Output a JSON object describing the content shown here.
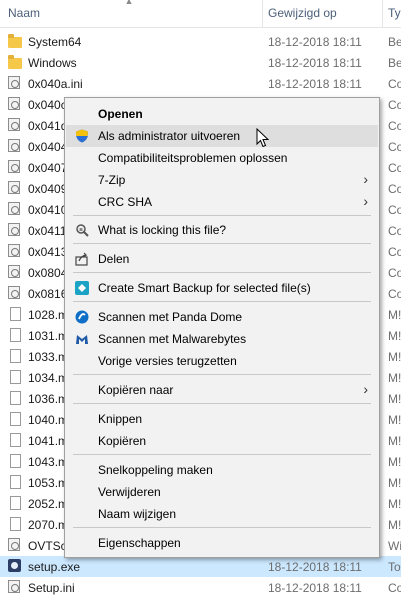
{
  "header": {
    "name": "Naam",
    "modified": "Gewijzigd op",
    "type": "Ty"
  },
  "rows": [
    {
      "name": "System64",
      "date": "18-12-2018 18:11",
      "type": "Be",
      "icon": "folder-icon"
    },
    {
      "name": "Windows",
      "date": "18-12-2018 18:11",
      "type": "Be",
      "icon": "folder-icon"
    },
    {
      "name": "0x040a.ini",
      "date": "18-12-2018 18:11",
      "type": "Co",
      "icon": "config-file-icon"
    },
    {
      "name": "0x040c",
      "date": "",
      "type": "Co",
      "icon": "config-file-icon"
    },
    {
      "name": "0x041d",
      "date": "",
      "type": "Co",
      "icon": "config-file-icon"
    },
    {
      "name": "0x0404",
      "date": "",
      "type": "Co",
      "icon": "config-file-icon"
    },
    {
      "name": "0x0407",
      "date": "",
      "type": "Co",
      "icon": "config-file-icon"
    },
    {
      "name": "0x0409",
      "date": "",
      "type": "Co",
      "icon": "config-file-icon"
    },
    {
      "name": "0x0410",
      "date": "",
      "type": "Co",
      "icon": "config-file-icon"
    },
    {
      "name": "0x0411",
      "date": "",
      "type": "Co",
      "icon": "config-file-icon"
    },
    {
      "name": "0x0413",
      "date": "",
      "type": "Co",
      "icon": "config-file-icon"
    },
    {
      "name": "0x0804",
      "date": "",
      "type": "Co",
      "icon": "config-file-icon"
    },
    {
      "name": "0x0816",
      "date": "",
      "type": "Co",
      "icon": "config-file-icon"
    },
    {
      "name": "1028.m",
      "date": "",
      "type": "M!",
      "icon": "document-icon"
    },
    {
      "name": "1031.m",
      "date": "",
      "type": "M!",
      "icon": "document-icon"
    },
    {
      "name": "1033.m",
      "date": "",
      "type": "M!",
      "icon": "document-icon"
    },
    {
      "name": "1034.m",
      "date": "",
      "type": "M!",
      "icon": "document-icon"
    },
    {
      "name": "1036.m",
      "date": "",
      "type": "M!",
      "icon": "document-icon"
    },
    {
      "name": "1040.m",
      "date": "",
      "type": "M!",
      "icon": "document-icon"
    },
    {
      "name": "1041.m",
      "date": "",
      "type": "M!",
      "icon": "document-icon"
    },
    {
      "name": "1043.m",
      "date": "",
      "type": "M!",
      "icon": "document-icon"
    },
    {
      "name": "1053.m",
      "date": "",
      "type": "M!",
      "icon": "document-icon"
    },
    {
      "name": "2052.m",
      "date": "",
      "type": "M!",
      "icon": "document-icon"
    },
    {
      "name": "2070.m",
      "date": "",
      "type": "M!",
      "icon": "document-icon"
    },
    {
      "name": "OVTSc",
      "date": "",
      "type": "Wi",
      "icon": "app-icon"
    },
    {
      "name": "setup.exe",
      "date": "18-12-2018 18:11",
      "type": "To",
      "icon": "exe-icon",
      "selected": true
    },
    {
      "name": "Setup.ini",
      "date": "18-12-2018 18:11",
      "type": "Co",
      "icon": "config-file-icon"
    }
  ],
  "menu": {
    "open": "Openen",
    "run_as_admin": "Als administrator uitvoeren",
    "compat": "Compatibiliteitsproblemen oplossen",
    "sevenzip": "7-Zip",
    "crcsha": "CRC SHA",
    "locking": "What is locking this file?",
    "share": "Delen",
    "smart_backup": "Create Smart Backup for selected file(s)",
    "panda": "Scannen met Panda Dome",
    "malwarebytes": "Scannen met Malwarebytes",
    "previous": "Vorige versies terugzetten",
    "copy_to": "Kopiëren naar",
    "cut": "Knippen",
    "copy": "Kopiëren",
    "shortcut": "Snelkoppeling maken",
    "delete": "Verwijderen",
    "rename": "Naam wijzigen",
    "properties": "Eigenschappen"
  },
  "colors": {
    "selection": "#cce8ff",
    "menu_bg": "#f2f2f2",
    "menu_hover": "#dedede",
    "header_text": "#4c607a"
  }
}
